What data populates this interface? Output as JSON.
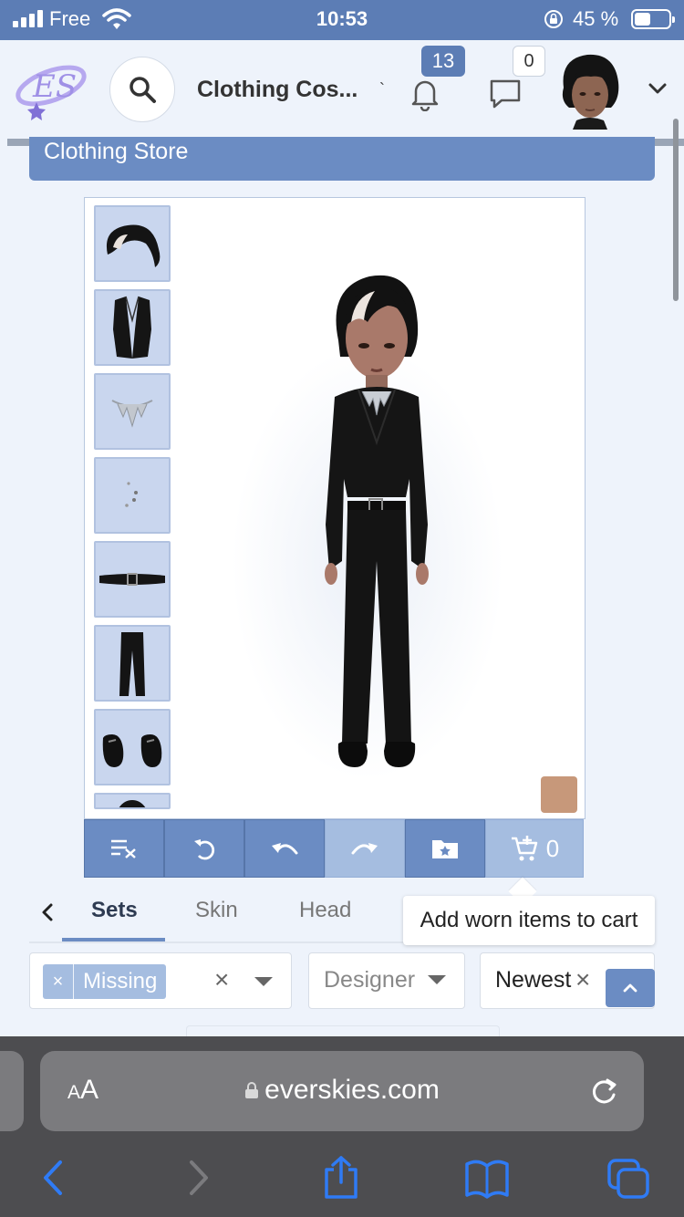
{
  "status_bar": {
    "carrier": "Free",
    "time": "10:53",
    "battery": "45 %",
    "battery_level": 0.45
  },
  "header": {
    "page_title": "Clothing Cos...",
    "notifications_count": "13",
    "messages_count": "0",
    "icons": [
      "everskies-logo-icon",
      "search-icon",
      "bell-icon",
      "chat-icon",
      "chevron-down-icon"
    ]
  },
  "banner": {
    "title": "Clothing Store"
  },
  "dressing_room": {
    "worn_items": [
      "hair",
      "jacket",
      "necklace",
      "earrings",
      "belt",
      "pants",
      "shoes",
      "top"
    ],
    "skin_tone": "#c7987a"
  },
  "toolbar": {
    "buttons": [
      "clear-all-icon",
      "reset-icon",
      "undo-icon",
      "redo-icon",
      "folder-star-icon",
      "cart-add-icon"
    ],
    "cart_count": "0",
    "tooltip": "Add worn items to cart"
  },
  "tabs": {
    "items": [
      "Sets",
      "Skin",
      "Head"
    ],
    "active": "Sets"
  },
  "filters": {
    "chip_label": "Missing",
    "chip_remove": "×",
    "clear_symbol": "×",
    "designer_placeholder": "Designer",
    "sort_value": "Newest"
  },
  "browser": {
    "aa_large": "A",
    "aa_small": "A",
    "url": "everskies.com",
    "icons": [
      "back-icon",
      "forward-icon",
      "share-icon",
      "bookmarks-icon",
      "tabs-icon"
    ]
  },
  "colors": {
    "accent": "#5c7db5",
    "banner": "#6b8cc3",
    "slot_bg": "#c9d6ee",
    "chip_bg": "#a5bde0"
  }
}
